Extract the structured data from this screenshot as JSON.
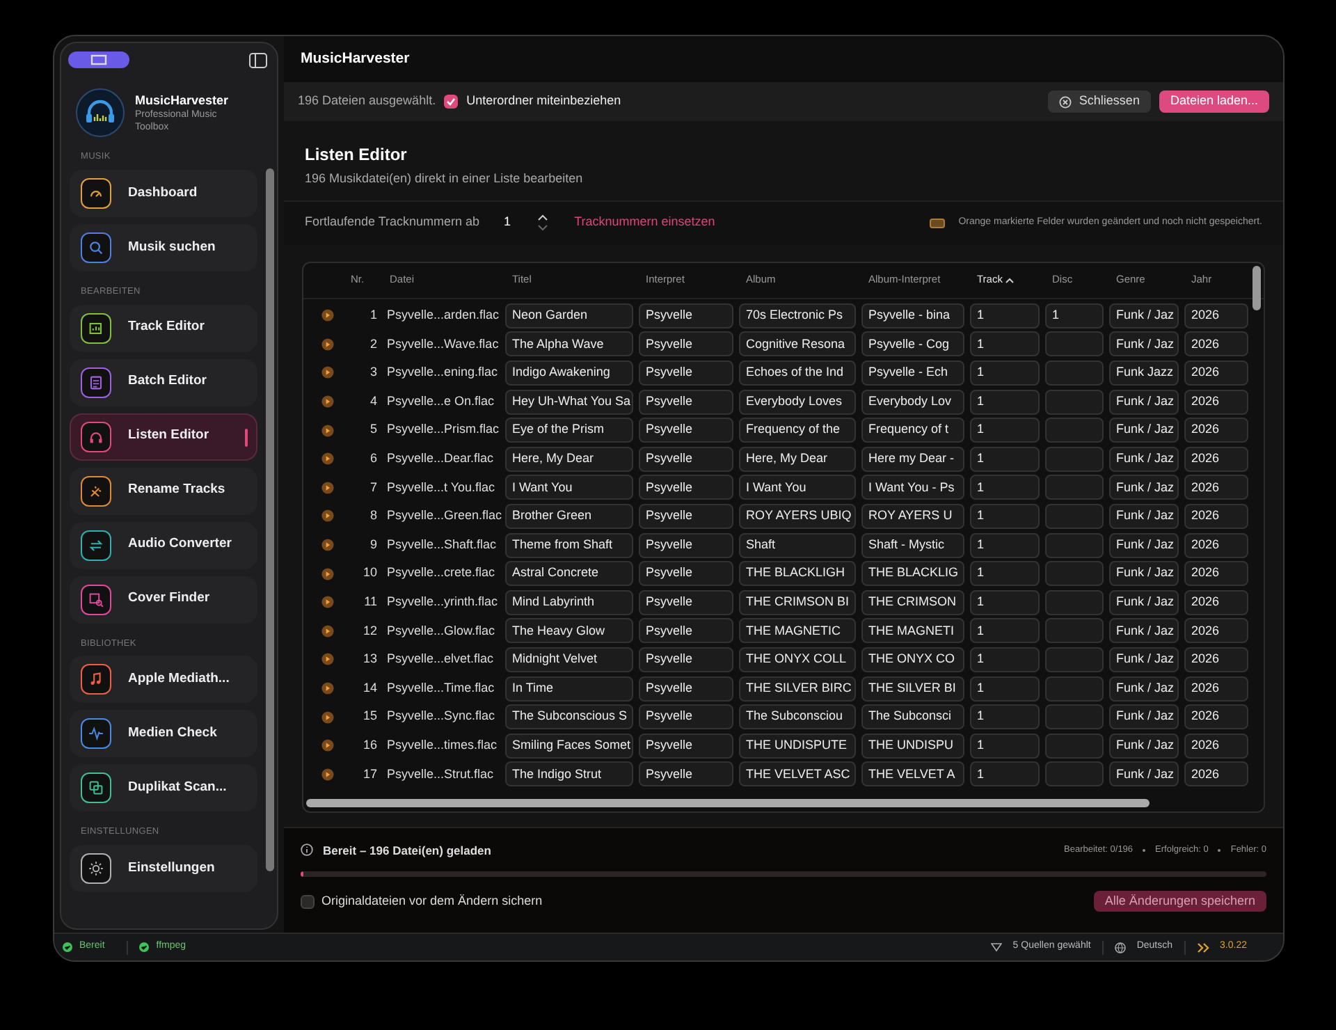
{
  "window": {
    "title": "MusicHarvester"
  },
  "sidebar": {
    "app_name": "MusicHarvester",
    "app_subtitle": "Professional Music Toolbox",
    "sections": [
      {
        "label": "MUSIK",
        "items": [
          {
            "label": "Dashboard",
            "color": "#e0a040",
            "selected": false
          },
          {
            "label": "Musik suchen",
            "color": "#4f7fe0",
            "selected": false
          }
        ]
      },
      {
        "label": "BEARBEITEN",
        "items": [
          {
            "label": "Track Editor",
            "color": "#7fc040",
            "selected": false
          },
          {
            "label": "Batch Editor",
            "color": "#a060e0",
            "selected": false
          },
          {
            "label": "Listen Editor",
            "color": "#e04a7a",
            "selected": true
          },
          {
            "label": "Rename Tracks",
            "color": "#e08a30",
            "selected": false
          },
          {
            "label": "Audio Converter",
            "color": "#30b0b0",
            "selected": false
          },
          {
            "label": "Cover Finder",
            "color": "#e04a9a",
            "selected": false
          }
        ]
      },
      {
        "label": "BIBLIOTHEK",
        "items": [
          {
            "label": "Apple Mediath...",
            "color": "#f06040",
            "selected": false
          },
          {
            "label": "Medien Check",
            "color": "#4a8ae0",
            "selected": false
          },
          {
            "label": "Duplikat Scan...",
            "color": "#40c090",
            "selected": false
          }
        ]
      },
      {
        "label": "EINSTELLUNGEN",
        "items": [
          {
            "label": "Einstellungen",
            "color": "#b0b0b0",
            "selected": false
          }
        ]
      }
    ]
  },
  "toolbar": {
    "selection_text": "196 Dateien ausgewählt.",
    "include_subfolders": {
      "label": "Unterordner miteinbeziehen",
      "checked": true
    },
    "close_button": "Schliessen",
    "load_button": "Dateien laden..."
  },
  "header": {
    "title": "Listen Editor",
    "subtitle": "196 Musikdatei(en) direkt in einer Liste bearbeiten"
  },
  "track_numbering": {
    "label": "Fortlaufende Tracknummern ab",
    "value": "1",
    "apply_button": "Tracknummern einsetzen",
    "legend": "Orange markierte Felder wurden geändert und noch nicht gespeichert."
  },
  "table": {
    "columns": [
      {
        "label": "Nr.",
        "sorted": false
      },
      {
        "label": "Datei",
        "sorted": false
      },
      {
        "label": "Titel",
        "sorted": false
      },
      {
        "label": "Interpret",
        "sorted": false
      },
      {
        "label": "Album",
        "sorted": false
      },
      {
        "label": "Album-Interpret",
        "sorted": false
      },
      {
        "label": "Track",
        "sorted": true
      },
      {
        "label": "Disc",
        "sorted": false
      },
      {
        "label": "Genre",
        "sorted": false
      },
      {
        "label": "Jahr",
        "sorted": false
      }
    ],
    "rows": [
      {
        "nr": "1",
        "file": "Psyvelle...arden.flac",
        "title": "Neon Garden",
        "artist": "Psyvelle",
        "album": "70s Electronic Ps",
        "album_artist": "Psyvelle - bina",
        "track": "1",
        "disc": "1",
        "genre": "Funk / Jaz",
        "year": "2026"
      },
      {
        "nr": "2",
        "file": "Psyvelle...Wave.flac",
        "title": "The Alpha Wave",
        "artist": "Psyvelle",
        "album": "Cognitive Resona",
        "album_artist": "Psyvelle - Cog",
        "track": "1",
        "genre": "Funk / Jaz",
        "year": "2026"
      },
      {
        "nr": "3",
        "file": "Psyvelle...ening.flac",
        "title": "Indigo Awakening",
        "artist": "Psyvelle",
        "album": "Echoes of the Ind",
        "album_artist": "Psyvelle - Ech",
        "track": "1",
        "genre": "Funk Jazz",
        "year": "2026"
      },
      {
        "nr": "4",
        "file": "Psyvelle...e On.flac",
        "title": "Hey Uh-What You Sa",
        "artist": "Psyvelle",
        "album": "Everybody Loves",
        "album_artist": "Everybody Lov",
        "track": "1",
        "genre": "Funk / Jaz",
        "year": "2026"
      },
      {
        "nr": "5",
        "file": "Psyvelle...Prism.flac",
        "title": "Eye of the Prism",
        "artist": "Psyvelle",
        "album": "Frequency of the",
        "album_artist": "Frequency of t",
        "track": "1",
        "genre": "Funk / Jaz",
        "year": "2026"
      },
      {
        "nr": "6",
        "file": "Psyvelle...Dear.flac",
        "title": "Here, My Dear",
        "artist": "Psyvelle",
        "album": "Here, My Dear",
        "album_artist": "Here my Dear -",
        "track": "1",
        "genre": "Funk / Jaz",
        "year": "2026"
      },
      {
        "nr": "7",
        "file": "Psyvelle...t You.flac",
        "title": "I Want You",
        "artist": "Psyvelle",
        "album": "I Want You",
        "album_artist": "I Want You - Ps",
        "track": "1",
        "genre": "Funk / Jaz",
        "year": "2026"
      },
      {
        "nr": "8",
        "file": "Psyvelle...Green.flac",
        "title": "Brother Green",
        "artist": "Psyvelle",
        "album": "ROY AYERS UBIQ",
        "album_artist": "ROY AYERS U",
        "track": "1",
        "genre": "Funk / Jaz",
        "year": "2026"
      },
      {
        "nr": "9",
        "file": "Psyvelle...Shaft.flac",
        "title": "Theme from Shaft",
        "artist": "Psyvelle",
        "album": "Shaft",
        "album_artist": "Shaft - Mystic",
        "track": "1",
        "genre": "Funk / Jaz",
        "year": "2026"
      },
      {
        "nr": "10",
        "file": "Psyvelle...crete.flac",
        "title": "Astral Concrete",
        "artist": "Psyvelle",
        "album": "THE BLACKLIGH",
        "album_artist": "THE BLACKLIG",
        "track": "1",
        "genre": "Funk / Jaz",
        "year": "2026"
      },
      {
        "nr": "11",
        "file": "Psyvelle...yrinth.flac",
        "title": "Mind Labyrinth",
        "artist": "Psyvelle",
        "album": "THE CRIMSON BI",
        "album_artist": "THE CRIMSON",
        "track": "1",
        "genre": "Funk / Jaz",
        "year": "2026"
      },
      {
        "nr": "12",
        "file": "Psyvelle...Glow.flac",
        "title": "The Heavy Glow",
        "artist": "Psyvelle",
        "album": "THE MAGNETIC",
        "album_artist": "THE MAGNETI",
        "track": "1",
        "genre": "Funk / Jaz",
        "year": "2026"
      },
      {
        "nr": "13",
        "file": "Psyvelle...elvet.flac",
        "title": "Midnight Velvet",
        "artist": "Psyvelle",
        "album": "THE ONYX COLL",
        "album_artist": "THE ONYX CO",
        "track": "1",
        "genre": "Funk / Jaz",
        "year": "2026"
      },
      {
        "nr": "14",
        "file": "Psyvelle...Time.flac",
        "title": "In Time",
        "artist": "Psyvelle",
        "album": "THE SILVER BIRC",
        "album_artist": "THE SILVER BI",
        "track": "1",
        "genre": "Funk / Jaz",
        "year": "2026"
      },
      {
        "nr": "15",
        "file": "Psyvelle...Sync.flac",
        "title": "The Subconscious S",
        "artist": "Psyvelle",
        "album": "The Subconsciou",
        "album_artist": "The Subconsci",
        "track": "1",
        "genre": "Funk / Jaz",
        "year": "2026"
      },
      {
        "nr": "16",
        "file": "Psyvelle...times.flac",
        "title": "Smiling Faces Somet",
        "artist": "Psyvelle",
        "album": "THE UNDISPUTE",
        "album_artist": "THE UNDISPU",
        "track": "1",
        "genre": "Funk / Jaz",
        "year": "2026"
      },
      {
        "nr": "17",
        "file": "Psyvelle...Strut.flac",
        "title": "The Indigo Strut",
        "artist": "Psyvelle",
        "album": "THE VELVET ASC",
        "album_artist": "THE VELVET A",
        "track": "1",
        "genre": "Funk / Jaz",
        "year": "2026"
      }
    ]
  },
  "progress": {
    "status": "Bereit – 196 Datei(en) geladen",
    "stats": [
      "Bearbeitet: 0/196",
      "Erfolgreich: 0",
      "Fehler: 0"
    ],
    "level": 0.003
  },
  "backup": {
    "label": "Originaldateien vor dem Ändern sichern",
    "checked": false
  },
  "save_button": {
    "label": "Alle Änderungen speichern",
    "disabled": true
  },
  "status_bar": {
    "left": [
      {
        "label": "Bereit",
        "ok": true
      },
      {
        "label": "ffmpeg",
        "ok": true
      }
    ],
    "sources": "5 Quellen gewählt",
    "language": "Deutsch",
    "version": "3.0.22"
  }
}
